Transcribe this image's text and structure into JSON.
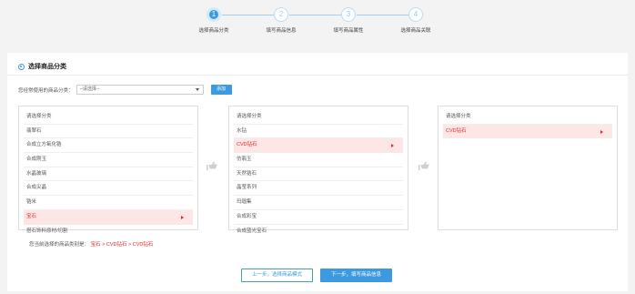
{
  "stepper": {
    "steps": [
      {
        "number": "1",
        "label": "选择商品分类"
      },
      {
        "number": "2",
        "label": "填写商品信息"
      },
      {
        "number": "3",
        "label": "填写商品属性"
      },
      {
        "number": "4",
        "label": "选择商品关联"
      }
    ],
    "active_index": 0
  },
  "section": {
    "title": "选择商品分类"
  },
  "recent": {
    "label": "您经常使用的商品分类：",
    "select_value": "--请选择--",
    "add_label": "添加"
  },
  "lists": [
    {
      "items": [
        "请选择分类",
        "翡翠石",
        "合成立方氧化锆",
        "合成刚玉",
        "水晶玻璃",
        "合成尖晶",
        "锆米",
        "宝石",
        "搭石饰料原材/切割"
      ],
      "selected": 7
    },
    {
      "items": [
        "请选择分类",
        "水钻",
        "CVD钻石",
        "仿翡玉",
        "天然锆石",
        "晶莹系列",
        "玛瑙集",
        "合成彩宝",
        "合成蓝光宝石"
      ],
      "selected": 2
    },
    {
      "items": [
        "请选择分类",
        "CVD钻石"
      ],
      "selected": 1
    }
  ],
  "selected_path": {
    "label": "您当前选择的商品类别是：",
    "level1": "宝石",
    "sep": " > ",
    "level2": "CVD钻石",
    "level3": "CVD钻石"
  },
  "buttons": {
    "prev_label": "上一步，选择商品模式",
    "next_label": "下一步，填写商品信息"
  },
  "colors": {
    "accent": "#3d9ae0",
    "selected_text": "#e5282a",
    "selected_bg": "#fde6e6"
  },
  "icons": {
    "pointer": "hand-pointing-right-icon",
    "arrow": "triangle-right-icon"
  }
}
